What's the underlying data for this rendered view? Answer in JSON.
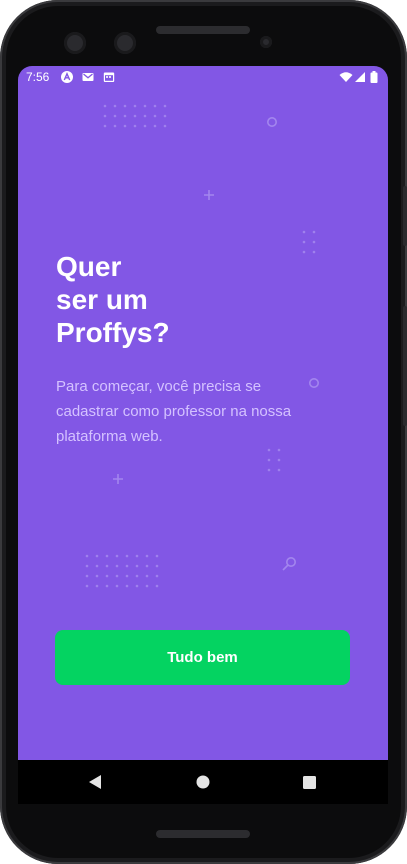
{
  "status_bar": {
    "time": "7:56",
    "left_icons": [
      "app-a-icon",
      "gmail-icon",
      "calendar-icon"
    ],
    "right_icons": [
      "wifi-icon",
      "signal-icon",
      "battery-icon"
    ]
  },
  "onboarding": {
    "title_lines": [
      "Quer",
      "ser um",
      "Proffys?"
    ],
    "description": "Para começar, você precisa se cadastrar como professor na nossa plataforma web.",
    "button_label": "Tudo bem"
  },
  "nav_bar": {
    "buttons": [
      "back-icon",
      "home-icon",
      "recents-icon"
    ]
  },
  "colors": {
    "background": "#8257e5",
    "text_primary": "#ffffff",
    "text_secondary": "#d4c2ff",
    "button": "#04d361"
  }
}
